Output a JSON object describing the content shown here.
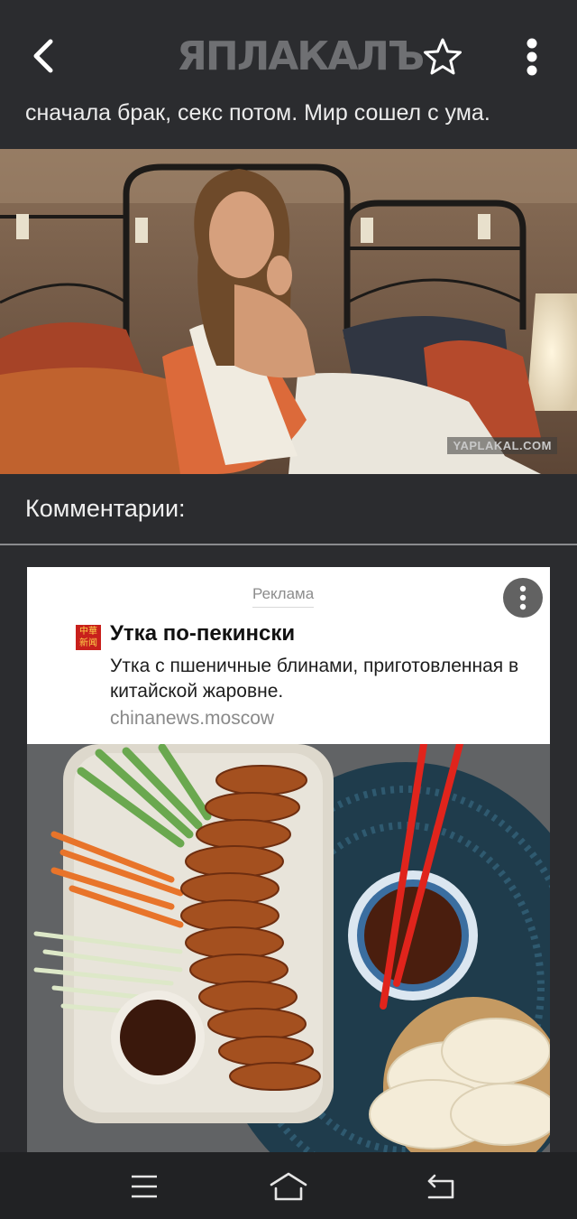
{
  "header": {
    "logo_text": "ЯПЛАКАЛЪ",
    "back_icon": "chevron-left-icon",
    "favorite_icon": "star-outline-icon",
    "more_icon": "vertical-dots-icon"
  },
  "post": {
    "text": "сначала брак, секс потом. Мир сошел с ума.",
    "image_watermark": "YAPLAKAL.COM"
  },
  "comments": {
    "title": "Комментарии:"
  },
  "ad": {
    "label": "Реклама",
    "logo_text": "中華新闻",
    "title": "Утка по-пекински",
    "description": "Утка с пшеничные блинами, приготовленная в китайской жаровне.",
    "domain": "chinanews.moscow"
  },
  "navbar": {
    "menu_icon": "menu-icon",
    "home_icon": "home-icon",
    "back_icon": "back-icon"
  },
  "colors": {
    "background": "#2b2c2f",
    "navbar": "#212224",
    "ad_card": "#ffffff",
    "text": "#ececec"
  }
}
